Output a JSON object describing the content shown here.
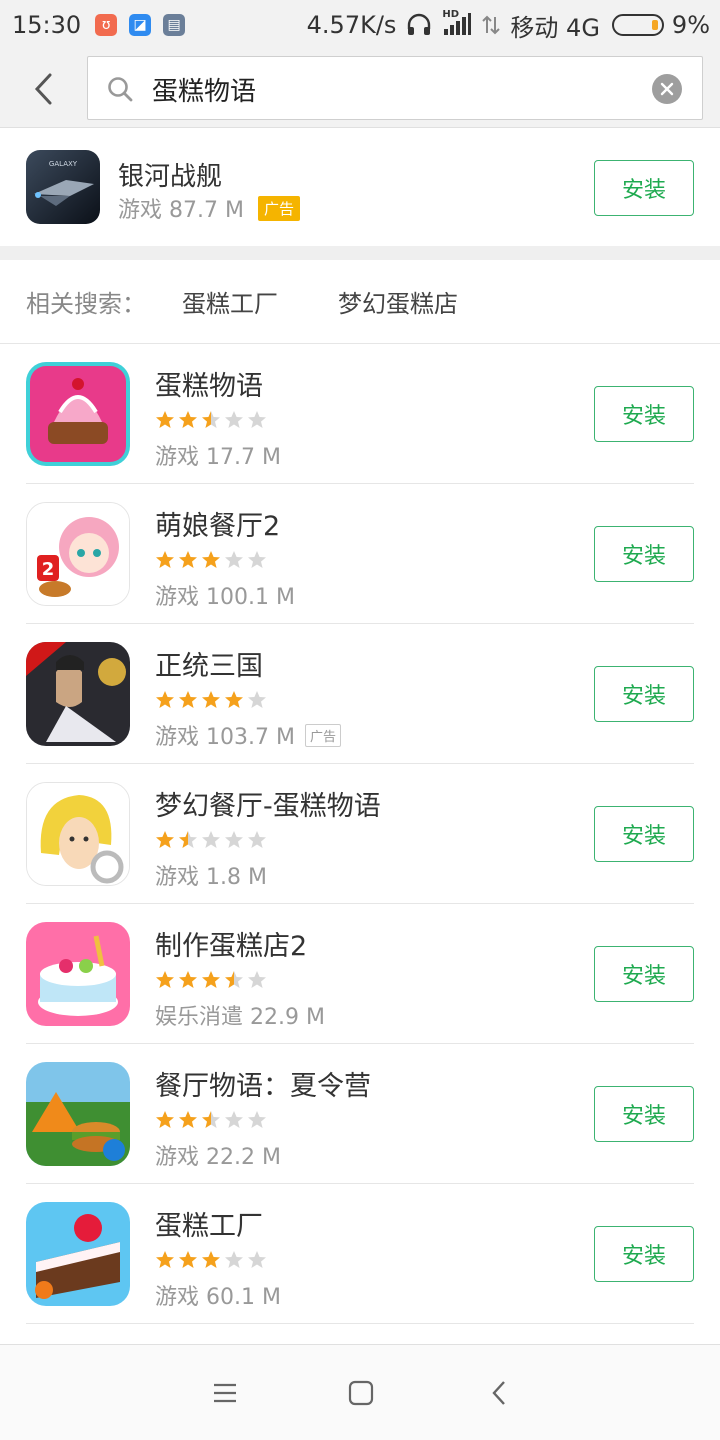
{
  "status_bar": {
    "time": "15:30",
    "net_speed": "4.57K/s",
    "hd": "HD",
    "carrier": "移动 4G",
    "battery": "9%"
  },
  "search": {
    "query": "蛋糕物语",
    "back_icon": "chevron-left-icon",
    "search_icon": "search-icon",
    "clear_icon": "close-icon"
  },
  "ad_app": {
    "name": "银河战舰",
    "meta": "游戏 87.7 M",
    "badge": "广告",
    "install": "安装"
  },
  "related": {
    "label": "相关搜索：",
    "items": [
      "蛋糕工厂",
      "梦幻蛋糕店"
    ]
  },
  "apps": [
    {
      "name": "蛋糕物语",
      "rating": 2.5,
      "meta": "游戏 17.7 M",
      "ad": "",
      "install": "安装"
    },
    {
      "name": "萌娘餐厅2",
      "rating": 3,
      "meta": "游戏 100.1 M",
      "ad": "",
      "install": "安装"
    },
    {
      "name": "正统三国",
      "rating": 4,
      "meta": "游戏 103.7 M",
      "ad": "广告",
      "install": "安装"
    },
    {
      "name": "梦幻餐厅-蛋糕物语",
      "rating": 1.5,
      "meta": "游戏 1.8 M",
      "ad": "",
      "install": "安装"
    },
    {
      "name": "制作蛋糕店2",
      "rating": 3.5,
      "meta": "娱乐消遣 22.9 M",
      "ad": "",
      "install": "安装"
    },
    {
      "name": "餐厅物语：夏令营",
      "rating": 2.5,
      "meta": "游戏 22.2 M",
      "ad": "",
      "install": "安装"
    },
    {
      "name": "蛋糕工厂",
      "rating": 3,
      "meta": "游戏 60.1 M",
      "ad": "",
      "install": "安装"
    }
  ],
  "colors": {
    "accent_green": "#1faa50",
    "star_orange": "#f5a11c",
    "star_gray": "#d6d6d6",
    "ad_badge": "#f5b400"
  }
}
